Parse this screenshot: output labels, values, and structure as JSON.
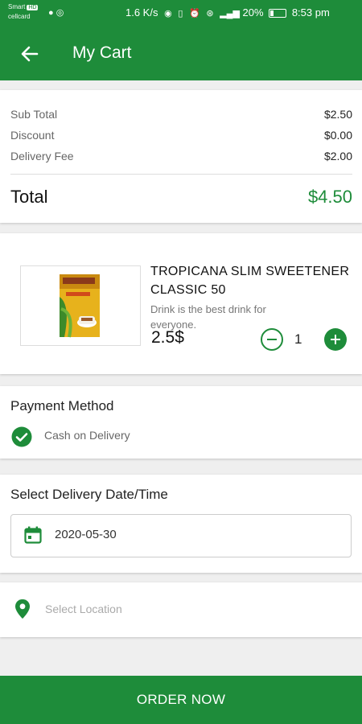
{
  "status_bar": {
    "carrier_line1": "Smart",
    "carrier_badge": "HD",
    "carrier_line2": "cellcard",
    "net_speed": "1.6 K/s",
    "battery_percent": "20%",
    "time": "8:53 pm"
  },
  "app_bar": {
    "title": "My Cart",
    "back_icon": "arrow-left-icon"
  },
  "summary": {
    "rows": [
      {
        "label": "Sub Total",
        "value": "$2.50"
      },
      {
        "label": "Discount",
        "value": "$0.00"
      },
      {
        "label": "Delivery Fee",
        "value": "$2.00"
      }
    ],
    "total_label": "Total",
    "total_value": "$4.50"
  },
  "cart_item": {
    "name": "TROPICANA SLIM SWEETENER CLASSIC 50",
    "description": "Drink is the best drink for everyone.",
    "price": "2.5$",
    "quantity": "1"
  },
  "payment": {
    "title": "Payment Method",
    "selected_option": "Cash on Delivery"
  },
  "delivery": {
    "title": "Select Delivery Date/Time",
    "date_value": "2020-05-30"
  },
  "location": {
    "placeholder": "Select Location"
  },
  "order_button": "ORDER NOW",
  "colors": {
    "primary": "#1e8c3a",
    "background": "#efefef"
  }
}
